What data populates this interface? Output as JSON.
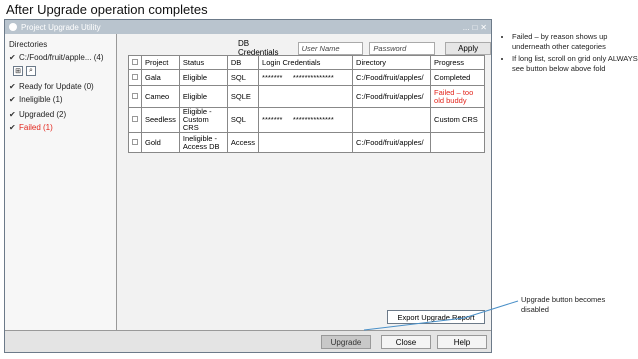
{
  "slide_title": "After Upgrade operation completes",
  "window": {
    "title": "Project Upgrade Utility",
    "controls": [
      "...",
      "□",
      "✕"
    ]
  },
  "sidebar": {
    "heading": "Directories",
    "directory": "C:/Food/fruit/apple... (4)",
    "items": [
      {
        "label": "Ready for Update (0)"
      },
      {
        "label": "Ineligible (1)"
      },
      {
        "label": "Upgraded (2)"
      },
      {
        "label": "Failed (1)"
      }
    ]
  },
  "credentials": {
    "label": "DB Credentials",
    "username_placeholder": "User Name",
    "password_placeholder": "Password",
    "apply_label": "Apply"
  },
  "table": {
    "headers": [
      "Project",
      "Status",
      "DB",
      "Login Credentials",
      "Directory",
      "Progress"
    ],
    "rows": [
      {
        "project": "Gala",
        "status": "Eligible",
        "db": "SQL",
        "user": "*******",
        "pass": "**************",
        "directory": "C:/Food/fruit/apples/",
        "progress": "Completed"
      },
      {
        "project": "Cameo",
        "status": "Eligible",
        "db": "SQLE",
        "user": "",
        "pass": "",
        "directory": "C:/Food/fruit/apples/",
        "progress": "Failed – too old buddy"
      },
      {
        "project": "Seedless",
        "status": "Eligible - Custom CRS",
        "db": "SQL",
        "user": "*******",
        "pass": "**************",
        "directory": "",
        "progress": "Custom CRS"
      },
      {
        "project": "Gold",
        "status": "Ineligible - Access DB",
        "db": "Access",
        "user": "",
        "pass": "",
        "directory": "C:/Food/fruit/apples/",
        "progress": ""
      }
    ]
  },
  "buttons": {
    "export": "Export Upgrade Report",
    "upgrade": "Upgrade",
    "close": "Close",
    "help": "Help"
  },
  "notes": [
    "Failed – by reason shows up underneath other categories",
    "If long list, scroll on grid only ALWAYS see button below above fold"
  ],
  "callout": "Upgrade button becomes disabled",
  "colors": {
    "failed": "#e3261d",
    "titlebar": "#b9c4ce",
    "callout_line": "#4a90c8"
  }
}
